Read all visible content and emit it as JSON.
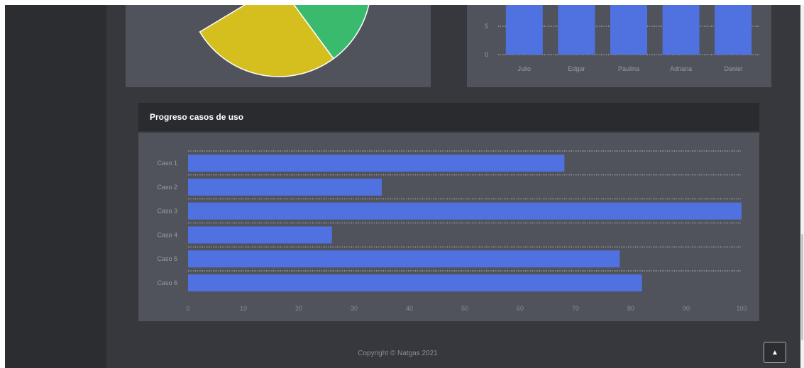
{
  "progress": {
    "title": "Progreso casos de uso"
  },
  "footer": {
    "copyright": "Copyright © Natgas 2021"
  },
  "scroll_top": {
    "icon": "chevron-up-icon"
  },
  "colors": {
    "bar": "#4f72e0",
    "pie_green": "#3aba6c",
    "pie_yellow": "#d4bf1f",
    "card": "#50535b",
    "sidebar": "#2c2d31"
  },
  "chart_data": [
    {
      "type": "pie",
      "slices": [
        {
          "label": "",
          "value": 30,
          "color": "#3aba6c"
        },
        {
          "label": "",
          "value": 35,
          "color": "#d4bf1f"
        }
      ]
    },
    {
      "type": "bar",
      "categories": [
        "Julio",
        "Edgar",
        "Paulina",
        "Adriana",
        "Daniel"
      ],
      "values": [
        12,
        12,
        12,
        12,
        12
      ],
      "yticks": [
        "0",
        "5"
      ],
      "ylim": [
        0,
        10
      ],
      "grid": true
    },
    {
      "type": "bar",
      "orientation": "horizontal",
      "title": "Progreso casos de uso",
      "categories": [
        "Caso 1",
        "Caso 2",
        "Caso 3",
        "Caso 4",
        "Caso 5",
        "Caso 6"
      ],
      "values": [
        68,
        35,
        100,
        26,
        78,
        82
      ],
      "xticks": [
        "0",
        "10",
        "20",
        "30",
        "40",
        "50",
        "60",
        "70",
        "80",
        "90",
        "100"
      ],
      "xlim": [
        0,
        100
      ],
      "grid": true
    }
  ]
}
